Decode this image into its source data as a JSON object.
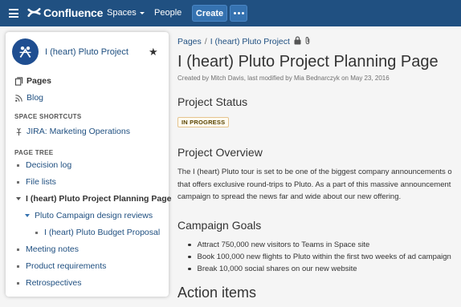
{
  "header": {
    "app_name": "Confluence",
    "nav": {
      "spaces": "Spaces",
      "people": "People"
    },
    "create_label": "Create",
    "brand_color": "#205081"
  },
  "sidebar": {
    "space_title": "I (heart) Pluto Project",
    "pages_label": "Pages",
    "blog_label": "Blog",
    "shortcuts_heading": "SPACE SHORTCUTS",
    "shortcuts": [
      {
        "label": "JIRA: Marketing Operations"
      }
    ],
    "tree_heading": "PAGE TREE",
    "tree": [
      {
        "label": "Decision log"
      },
      {
        "label": "File lists"
      },
      {
        "label": "I (heart) Pluto Project Planning Page"
      },
      {
        "label": "Pluto Campaign design reviews"
      },
      {
        "label": "I (heart) Pluto Budget Proposal"
      },
      {
        "label": "Meeting notes"
      },
      {
        "label": "Product requirements"
      },
      {
        "label": "Retrospectives"
      }
    ]
  },
  "main": {
    "breadcrumbs": [
      "Pages",
      "I (heart) Pluto Project"
    ],
    "title": "I (heart) Pluto Project Planning Page",
    "byline": "Created by Mitch Davis, last modified by Mia Bednarczyk on May 23, 2016",
    "status_heading": "Project Status",
    "status": "IN PROGRESS",
    "overview_heading": "Project Overview",
    "overview_lines": [
      "The I (heart) Pluto tour is set to be one of the biggest company announcements o",
      "that offers exclusive round-trips to Pluto. As a part of this massive announcement",
      "campaign to spread the news far and wide about our new offering."
    ],
    "goals_heading": "Campaign Goals",
    "goals": [
      "Attract 750,000 new visitors to Teams in Space site",
      "Book 100,000 new flights to Pluto within the first two weeks of ad campaign",
      "Break 10,000 social shares on our new website"
    ],
    "action_heading": "Action items"
  }
}
